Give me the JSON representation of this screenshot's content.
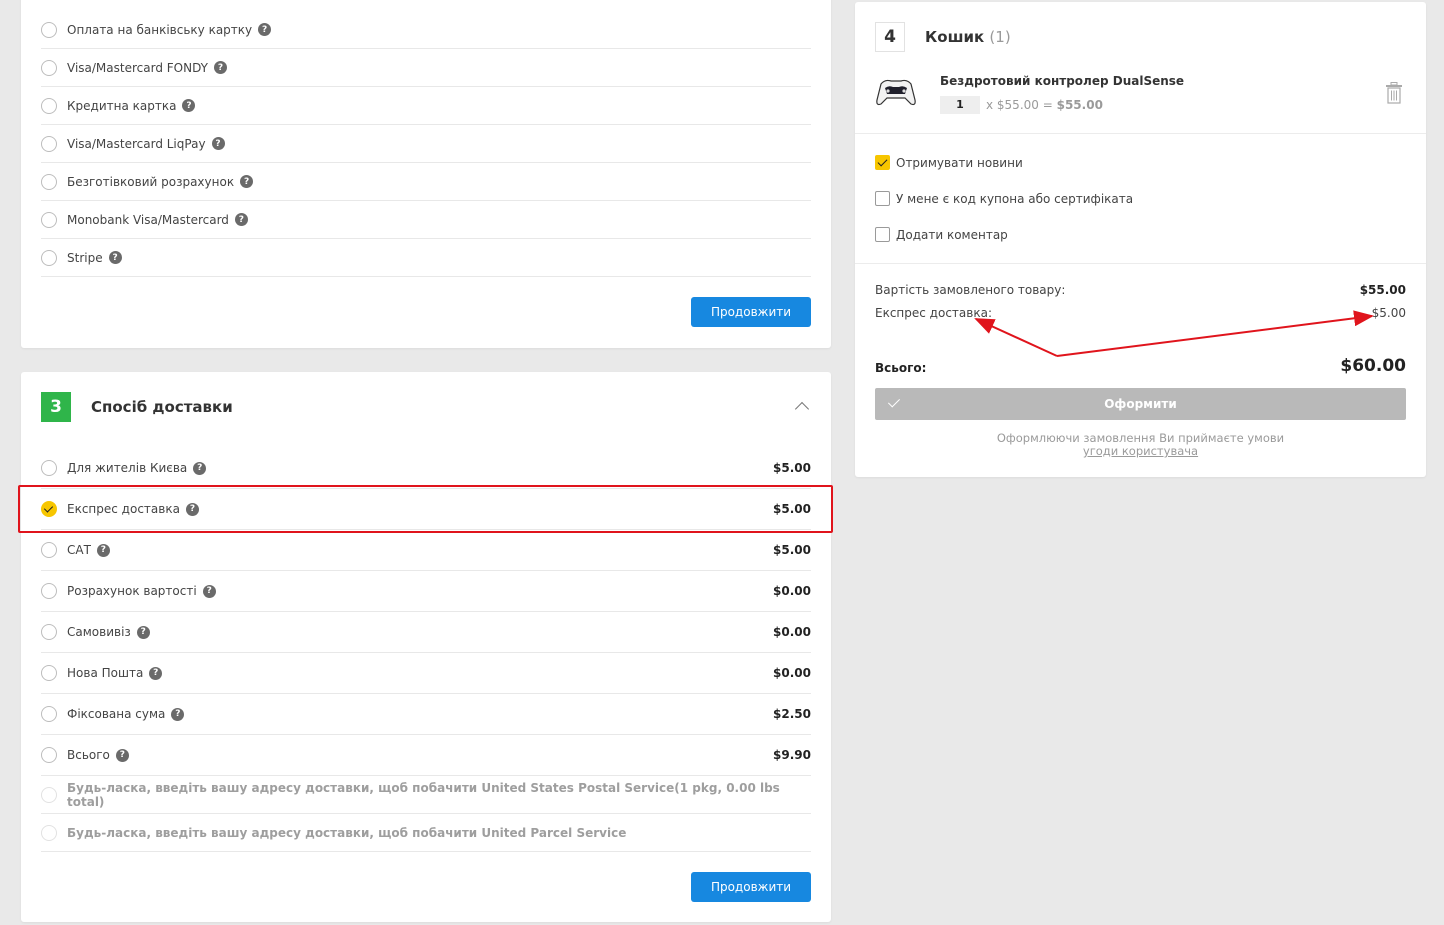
{
  "payment": {
    "methods": [
      {
        "label": "Оплата на банківську картку"
      },
      {
        "label": "Visa/Mastercard FONDY"
      },
      {
        "label": "Кредитна картка"
      },
      {
        "label": "Visa/Mastercard LiqPay"
      },
      {
        "label": "Безготівковий розрахунок"
      },
      {
        "label": "Monobank Visa/Mastercard"
      },
      {
        "label": "Stripe"
      }
    ],
    "continue_label": "Продовжити"
  },
  "delivery": {
    "step_number": "3",
    "title": "Спосіб доставки",
    "options": [
      {
        "label": "Для жителів Києва",
        "price": "$5.00",
        "selected": false
      },
      {
        "label": "Експрес доставка",
        "price": "$5.00",
        "selected": true
      },
      {
        "label": "САТ",
        "price": "$5.00",
        "selected": false
      },
      {
        "label": "Розрахунок вартості",
        "price": "$0.00",
        "selected": false
      },
      {
        "label": "Самовивіз",
        "price": "$0.00",
        "selected": false
      },
      {
        "label": "Нова Пошта",
        "price": "$0.00",
        "selected": false
      },
      {
        "label": "Фіксована сума",
        "price": "$2.50",
        "selected": false
      },
      {
        "label": "Всього",
        "price": "$9.90",
        "selected": false
      }
    ],
    "notices": [
      "Будь-ласка, введіть вашу адресу доставки, щоб побачити United States Postal Service(1 pkg, 0.00 lbs total)",
      "Будь-ласка, введіть вашу адресу доставки, щоб побачити United Parcel Service"
    ],
    "continue_label": "Продовжити"
  },
  "cart": {
    "step_number": "4",
    "title": "Кошик",
    "count": "(1)",
    "item": {
      "name": "Бездротовий контролер DualSense",
      "qty": "1",
      "unit_price_text": "x $55.00 =",
      "line_total": "$55.00"
    },
    "options": {
      "newsletter": "Отримувати новини",
      "coupon": "У мене є код купона або сертифіката",
      "comment": "Додати коментар"
    },
    "summary": {
      "subtotal_label": "Вартість замовленого товару:",
      "subtotal_value": "$55.00",
      "shipping_label": "Експрес доставка:",
      "shipping_value": "$5.00",
      "total_label": "Всього:",
      "total_value": "$60.00"
    },
    "checkout_label": "Оформити",
    "terms_text": "Оформлюючи замовлення Ви приймаєте умови",
    "terms_link": "угоди користувача"
  },
  "colors": {
    "primary": "#1788e0",
    "step_green": "#2fb54a",
    "selected_yellow": "#f7c600",
    "annotation_red": "#e0141c"
  }
}
